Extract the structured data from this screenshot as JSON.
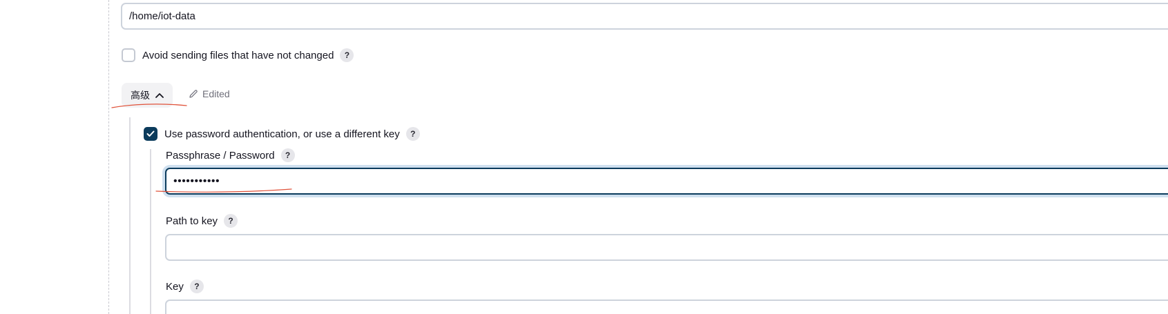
{
  "remote_directory": {
    "value": "/home/iot-data"
  },
  "avoid_unchanged": {
    "label": "Avoid sending files that have not changed",
    "checked": false,
    "help": "?"
  },
  "advanced": {
    "label": "高级",
    "expanded": true,
    "edited_label": "Edited"
  },
  "use_password": {
    "label": "Use password authentication, or use a different key",
    "checked": true,
    "help": "?"
  },
  "passphrase": {
    "label": "Passphrase / Password",
    "value": "•••••••••••",
    "help": "?"
  },
  "path_to_key": {
    "label": "Path to key",
    "value": "",
    "help": "?"
  },
  "key": {
    "label": "Key",
    "value": "",
    "help": "?"
  },
  "colors": {
    "checkbox_checked": "#0b3b5c",
    "focus_ring": "#cfe0ef",
    "annotation": "#e0523a"
  },
  "icons": {
    "help": "question-mark-circle",
    "advanced": "chevron-up",
    "edited": "pencil",
    "checked": "checkmark"
  }
}
